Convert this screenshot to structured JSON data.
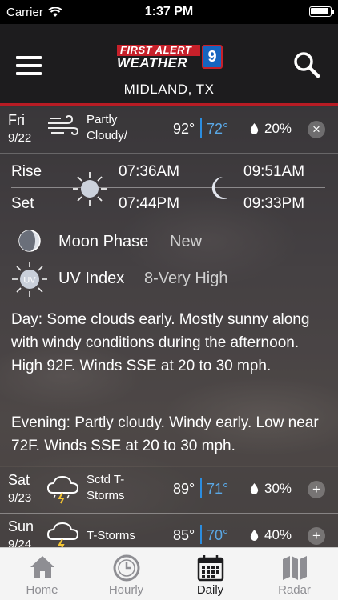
{
  "status_bar": {
    "carrier": "Carrier",
    "time": "1:37 PM"
  },
  "header": {
    "logo_line1": "FIRST ALERT",
    "logo_line2": "WEATHER",
    "logo_badge": "9",
    "location": "MIDLAND, TX"
  },
  "days": [
    {
      "dow": "Fri",
      "date": "9/22",
      "condition": "Partly Cloudy/",
      "icon": "wind-icon",
      "high": "92°",
      "low": "72°",
      "precip": "20%",
      "toggle": "×"
    },
    {
      "dow": "Sat",
      "date": "9/23",
      "condition": "Sctd T-Storms",
      "icon": "thunderstorm-icon",
      "high": "89°",
      "low": "71°",
      "precip": "30%",
      "toggle": "+"
    },
    {
      "dow": "Sun",
      "date": "9/24",
      "condition": "T-Storms",
      "icon": "thunderstorm-icon",
      "high": "85°",
      "low": "70°",
      "precip": "40%",
      "toggle": "+"
    }
  ],
  "detail": {
    "rise_label": "Rise",
    "set_label": "Set",
    "sunrise": "07:36AM",
    "sunset": "07:44PM",
    "moonrise": "09:51AM",
    "moonset": "09:33PM",
    "moon_phase_label": "Moon Phase",
    "moon_phase_value": "New",
    "uv_label": "UV Index",
    "uv_value": "8-Very High",
    "uv_icon_text": "UV",
    "day_text": "Day: Some clouds early. Mostly sunny along with windy conditions during the afternoon. High 92F. Winds SSE at 20 to 30 mph.",
    "evening_text": "Evening: Partly cloudy. Windy early. Low near 72F. Winds SSE at 20 to 30 mph."
  },
  "tabs": [
    {
      "label": "Home",
      "icon": "home-icon",
      "active": false
    },
    {
      "label": "Hourly",
      "icon": "clock-icon",
      "active": false
    },
    {
      "label": "Daily",
      "icon": "calendar-icon",
      "active": true
    },
    {
      "label": "Radar",
      "icon": "map-icon",
      "active": false
    }
  ],
  "colors": {
    "accent_red": "#b71c24",
    "low_temp_blue": "#5aa8e6"
  }
}
